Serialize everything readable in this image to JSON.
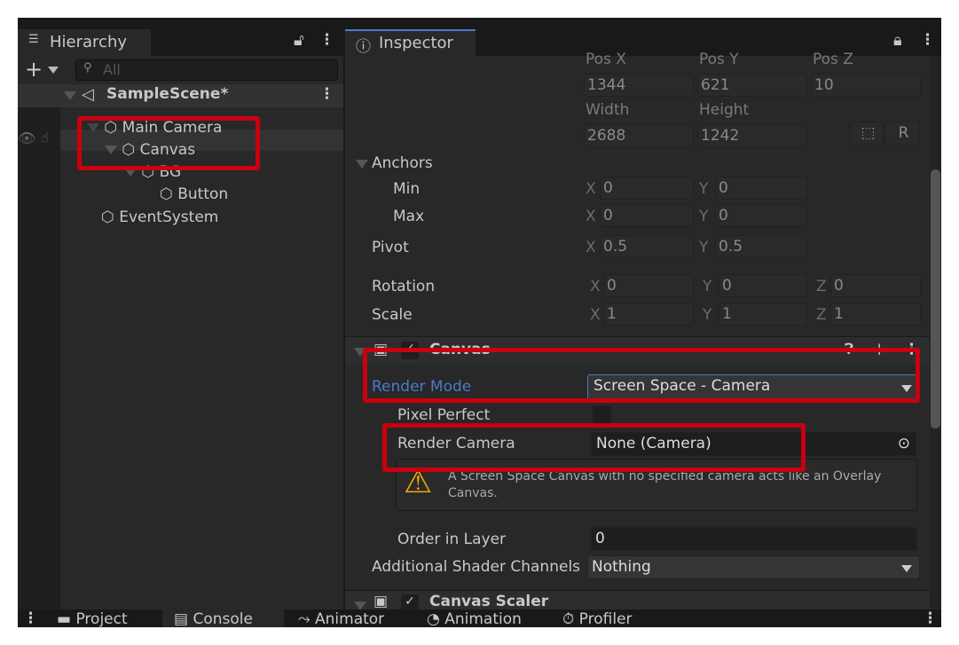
{
  "hierarchy": {
    "title": "Hierarchy",
    "search_placeholder": "All",
    "scene": "SampleScene*",
    "items": [
      {
        "label": "Main Camera"
      },
      {
        "label": "Canvas"
      },
      {
        "label": "BG"
      },
      {
        "label": "Button"
      },
      {
        "label": "EventSystem"
      }
    ]
  },
  "inspector": {
    "title": "Inspector",
    "rect": {
      "pos_x_label": "Pos X",
      "pos_y_label": "Pos Y",
      "pos_z_label": "Pos Z",
      "pos_x": "1344",
      "pos_y": "621",
      "pos_z": "10",
      "width_label": "Width",
      "height_label": "Height",
      "width": "2688",
      "height": "1242",
      "raw_button": "R",
      "anchors_label": "Anchors",
      "min_label": "Min",
      "max_label": "Max",
      "min_x": "0",
      "min_y": "0",
      "max_x": "0",
      "max_y": "0",
      "pivot_label": "Pivot",
      "pivot_x": "0.5",
      "pivot_y": "0.5",
      "rotation_label": "Rotation",
      "rot_x": "0",
      "rot_y": "0",
      "rot_z": "0",
      "scale_label": "Scale",
      "scale_x": "1",
      "scale_y": "1",
      "scale_z": "1",
      "x": "X",
      "y": "Y",
      "z": "Z"
    },
    "canvas": {
      "title": "Canvas",
      "enabled": true,
      "render_mode_label": "Render Mode",
      "render_mode": "Screen Space - Camera",
      "pixel_perfect_label": "Pixel Perfect",
      "pixel_perfect": false,
      "render_camera_label": "Render Camera",
      "render_camera": "None (Camera)",
      "warning": "A Screen Space Canvas with no specified camera acts like an Overlay Canvas.",
      "order_label": "Order in Layer",
      "order": "0",
      "shader_label": "Additional Shader Channels",
      "shader": "Nothing"
    },
    "canvas_scaler": {
      "title": "Canvas Scaler"
    }
  },
  "bottom_tabs": [
    "Project",
    "Console",
    "Animator",
    "Animation",
    "Profiler"
  ],
  "colors": {
    "highlight": "#c8000f",
    "accent": "#4d78cc",
    "warning": "#f5a800"
  }
}
